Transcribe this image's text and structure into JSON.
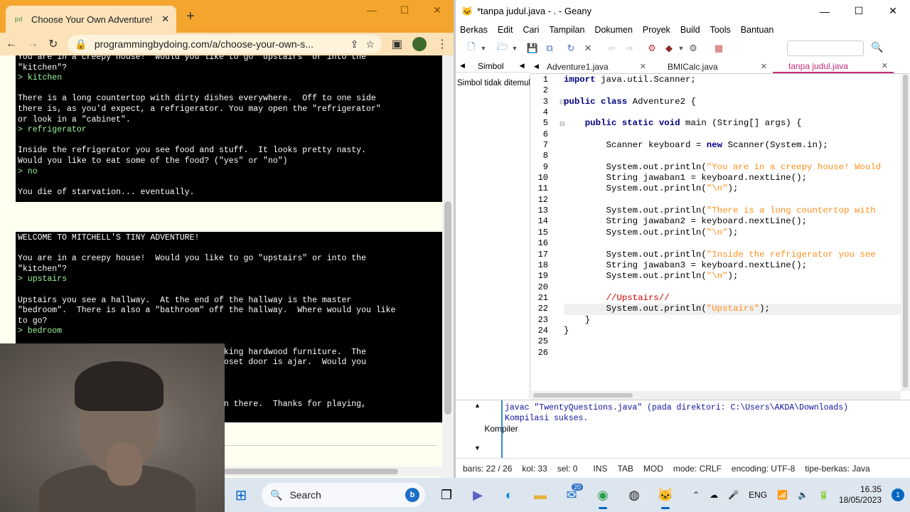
{
  "browser": {
    "tab_title": "Choose Your Own Adventure!",
    "favicon_text": "pd",
    "url": "programmingbydoing.com/a/choose-your-own-s...",
    "win_controls": [
      "—",
      "☐",
      "✕"
    ]
  },
  "terminal_top": {
    "lines": [
      {
        "t": "You are in a creepy house!  Would you like to go \"upstairs\" or into the",
        "in": false
      },
      {
        "t": "\"kitchen\"?",
        "in": false
      },
      {
        "t": "> kitchen",
        "in": true
      },
      {
        "t": "",
        "in": false
      },
      {
        "t": "There is a long countertop with dirty dishes everywhere.  Off to one side",
        "in": false
      },
      {
        "t": "there is, as you'd expect, a refrigerator. You may open the \"refrigerator\"",
        "in": false
      },
      {
        "t": "or look in a \"cabinet\".",
        "in": false
      },
      {
        "t": "> refrigerator",
        "in": true
      },
      {
        "t": "",
        "in": false
      },
      {
        "t": "Inside the refrigerator you see food and stuff.  It looks pretty nasty.",
        "in": false
      },
      {
        "t": "Would you like to eat some of the food? (\"yes\" or \"no\")",
        "in": false
      },
      {
        "t": "> no",
        "in": true
      },
      {
        "t": "",
        "in": false
      },
      {
        "t": "You die of starvation... eventually.",
        "in": false
      }
    ]
  },
  "terminal_bottom": {
    "lines": [
      {
        "t": "WELCOME TO MITCHELL'S TINY ADVENTURE!",
        "in": false
      },
      {
        "t": "",
        "in": false
      },
      {
        "t": "You are in a creepy house!  Would you like to go \"upstairs\" or into the",
        "in": false
      },
      {
        "t": "\"kitchen\"?",
        "in": false
      },
      {
        "t": "> upstairs",
        "in": true
      },
      {
        "t": "",
        "in": false
      },
      {
        "t": "Upstairs you see a hallway.  At the end of the hallway is the master",
        "in": false
      },
      {
        "t": "\"bedroom\".  There is also a \"bathroom\" off the hallway.  Where would you like",
        "in": false
      },
      {
        "t": "to go?",
        "in": false
      },
      {
        "t": "> bedroom",
        "in": true
      },
      {
        "t": "",
        "in": false
      },
      {
        "t": "                                        ooking hardwood furniture.  The",
        "in": false
      },
      {
        "t": "                                        closet door is ajar.  Would you",
        "in": false
      },
      {
        "t": "",
        "in": false
      },
      {
        "t": "",
        "in": false
      },
      {
        "t": "",
        "in": false
      },
      {
        "t": "                                       s in there.  Thanks for playing,",
        "in": false
      }
    ]
  },
  "geany": {
    "title": "*tanpa judul.java - . - Geany",
    "menu": [
      "Berkas",
      "Edit",
      "Cari",
      "Tampilan",
      "Dokumen",
      "Proyek",
      "Build",
      "Tools",
      "Bantuan"
    ],
    "side_tab": "Simbol",
    "side_text": "Simbol tidak ditemukan",
    "doc_tabs": [
      {
        "label": "Adventure1.java",
        "active": false
      },
      {
        "label": "BMICalc.java",
        "active": false
      },
      {
        "label": "tanpa judul.java",
        "active": true
      }
    ],
    "line_numbers": [
      "1",
      "2",
      "3",
      "4",
      "5",
      "6",
      "7",
      "8",
      "9",
      "10",
      "11",
      "12",
      "13",
      "14",
      "15",
      "16",
      "17",
      "18",
      "19",
      "20",
      "21",
      "22",
      "23",
      "24",
      "25",
      "26"
    ],
    "code": [
      [
        [
          "kw",
          "import"
        ],
        [
          "typ",
          " java.util.Scanner;"
        ]
      ],
      [],
      [
        [
          "kw",
          "public class"
        ],
        [
          "typ",
          " Adventure2 {"
        ]
      ],
      [],
      [
        [
          "typ",
          "    "
        ],
        [
          "kw",
          "public static void"
        ],
        [
          "typ",
          " main (String[] args) {"
        ]
      ],
      [],
      [
        [
          "typ",
          "        Scanner keyboard = "
        ],
        [
          "kw",
          "new"
        ],
        [
          "typ",
          " Scanner(System.in);"
        ]
      ],
      [],
      [
        [
          "typ",
          "        System.out.println("
        ],
        [
          "str",
          "\"You are in a creepy house! Would"
        ]
      ],
      [
        [
          "typ",
          "        String jawaban1 = keyboard.nextLine();"
        ]
      ],
      [
        [
          "typ",
          "        System.out.println("
        ],
        [
          "str",
          "\"\\n\""
        ],
        [
          "typ",
          ");"
        ]
      ],
      [],
      [
        [
          "typ",
          "        System.out.println("
        ],
        [
          "str",
          "\"There is a long countertop with"
        ]
      ],
      [
        [
          "typ",
          "        String jawaban2 = keyboard.nextLine();"
        ]
      ],
      [
        [
          "typ",
          "        System.out.println("
        ],
        [
          "str",
          "\"\\n\""
        ],
        [
          "typ",
          ");"
        ]
      ],
      [],
      [
        [
          "typ",
          "        System.out.println("
        ],
        [
          "str",
          "\"Inside the refrigerator you see"
        ]
      ],
      [
        [
          "typ",
          "        String jawaban3 = keyboard.nextLine();"
        ]
      ],
      [
        [
          "typ",
          "        System.out.println("
        ],
        [
          "str",
          "\"\\n\""
        ],
        [
          "typ",
          ");"
        ]
      ],
      [],
      [
        [
          "cmt",
          "        //Upstairs//"
        ]
      ],
      [
        [
          "typ",
          "        System.out.println("
        ],
        [
          "str",
          "\"Upstairs\""
        ],
        [
          "typ",
          ");"
        ]
      ],
      [
        [
          "typ",
          "    }"
        ]
      ],
      [
        [
          "typ",
          "}"
        ]
      ],
      [],
      []
    ],
    "current_line": 22,
    "message_label": "Kompiler",
    "messages": [
      "javac \"TwentyQuestions.java\" (pada direktori: C:\\Users\\AKDA\\Downloads)",
      "Kompilasi sukses."
    ],
    "status": {
      "baris": "baris: 22 / 26",
      "kol": "kol: 33",
      "sel": "sel: 0",
      "ins": "INS",
      "tab": "TAB",
      "mod": "MOD",
      "mode": "mode: CRLF",
      "encoding": "encoding: UTF-8",
      "filetype": "tipe-berkas: Java"
    }
  },
  "taskbar": {
    "search_label": "Search",
    "mail_badge": "20",
    "lang": "ENG",
    "time": "16.35",
    "date": "18/05/2023",
    "notif_count": "1"
  },
  "colors": {
    "chrome_accent": "#f4a52e",
    "terminal_bg": "#000000",
    "terminal_input": "#9cf79c",
    "geany_active_tab": "#c52b7a",
    "keyword": "#00007f",
    "string": "#ff901e",
    "comment": "#d00000"
  }
}
